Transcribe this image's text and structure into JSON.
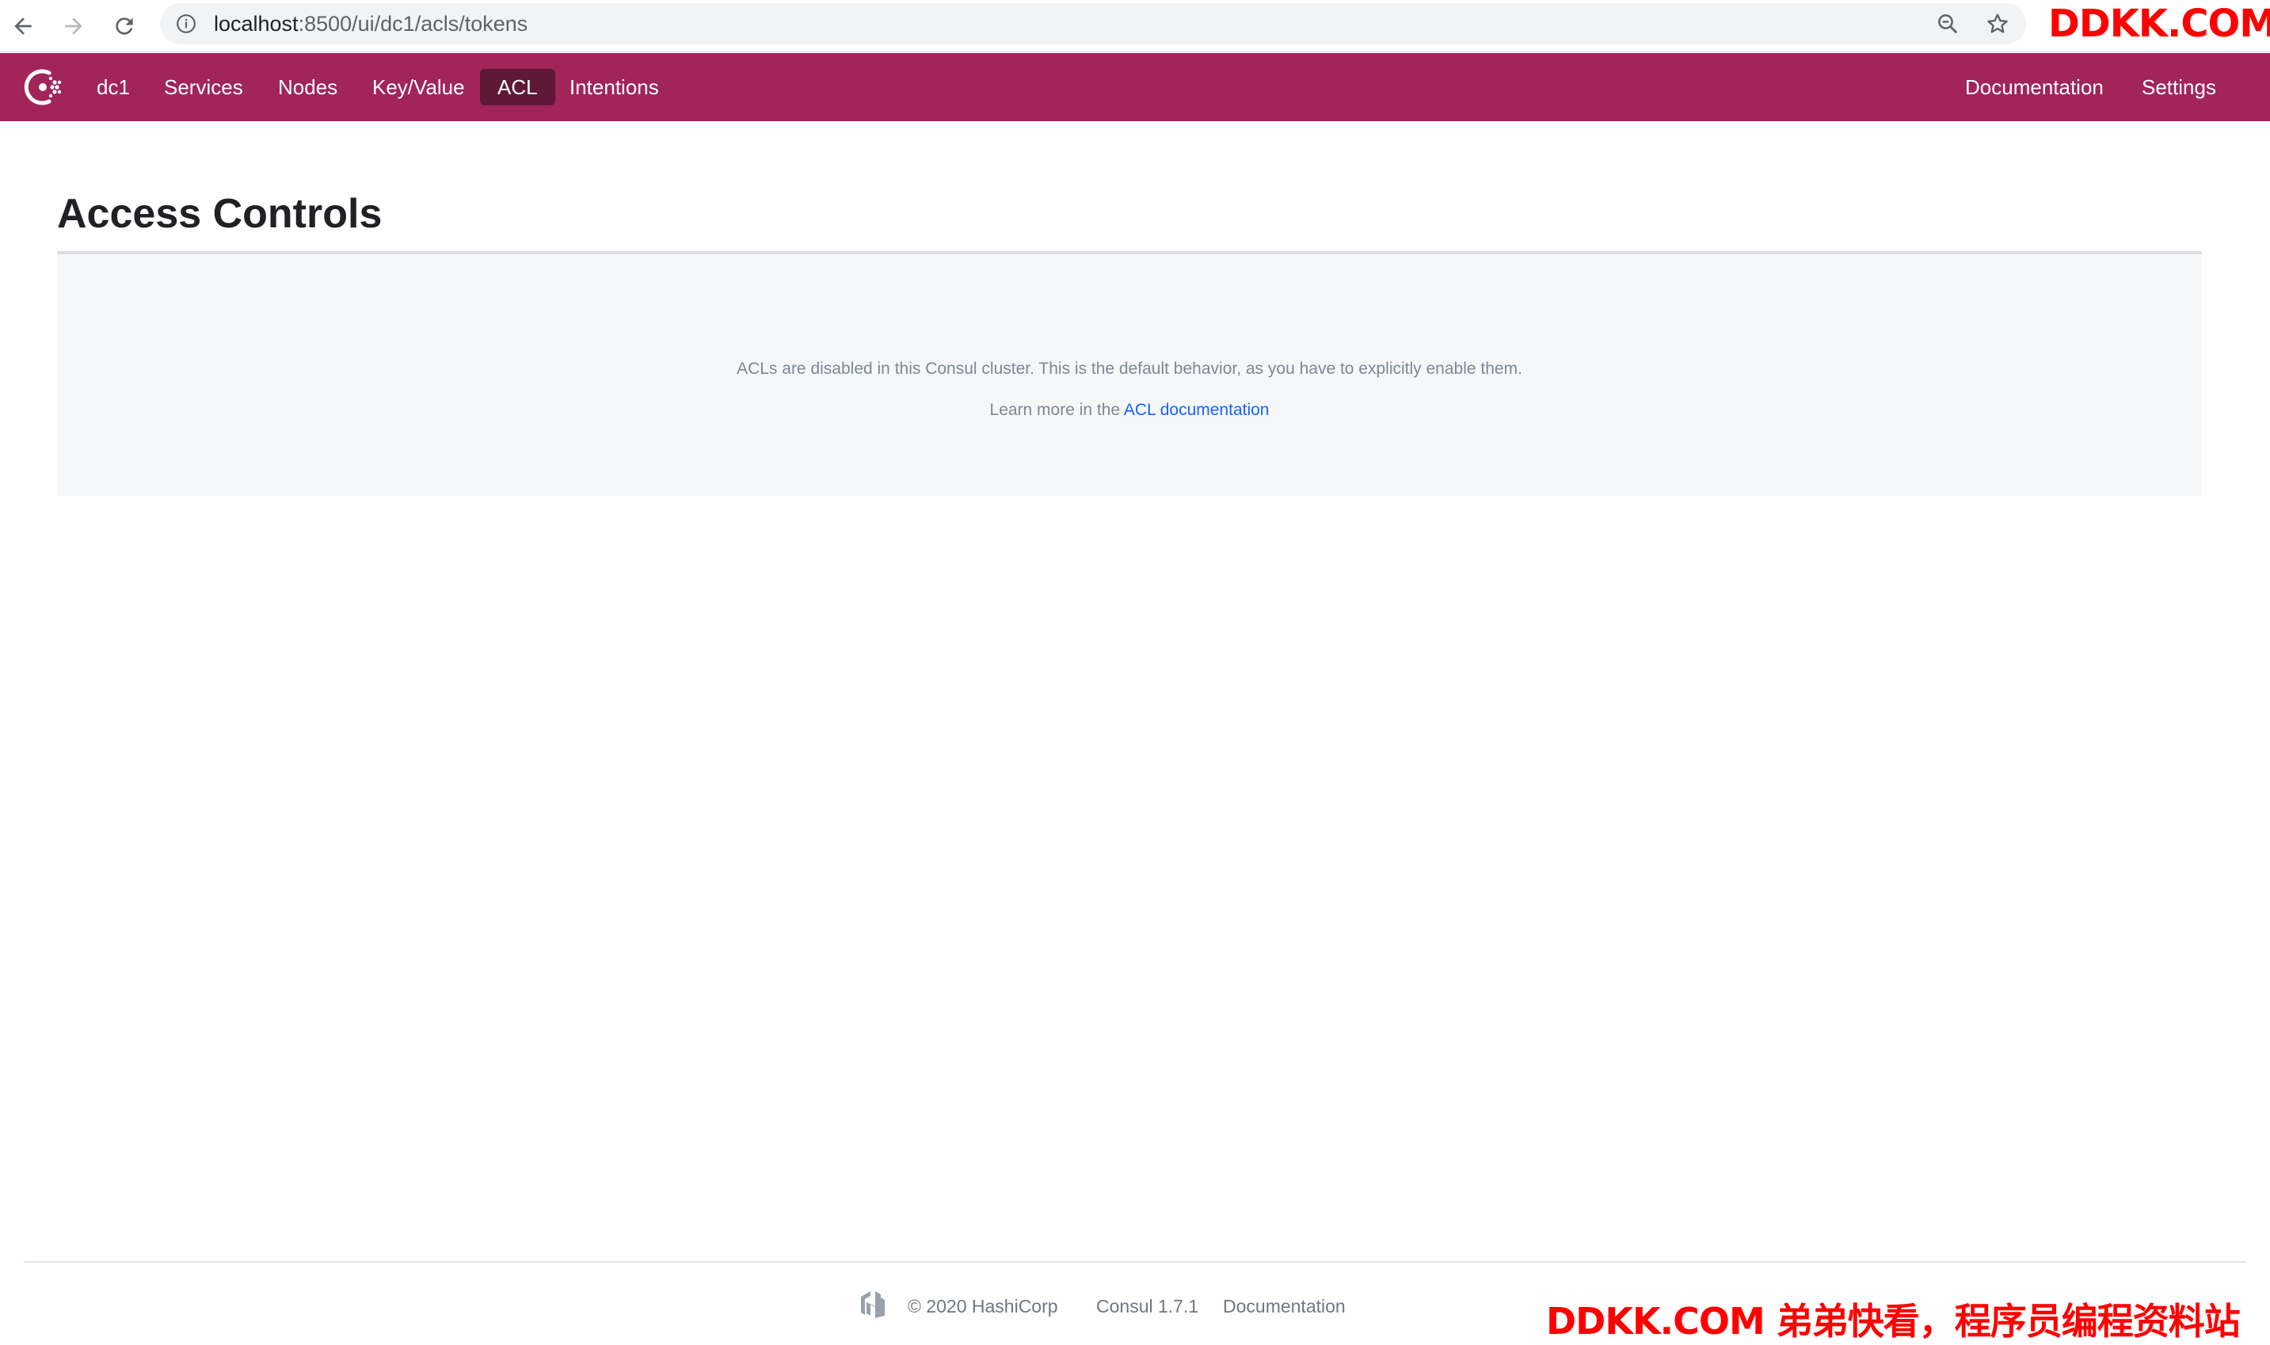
{
  "browser": {
    "url_host": "localhost",
    "url_path": ":8500/ui/dc1/acls/tokens",
    "icons": [
      "back-icon",
      "forward-icon",
      "reload-icon",
      "info-icon",
      "zoom-icon",
      "star-icon"
    ]
  },
  "header": {
    "datacenter": "dc1",
    "nav": {
      "services": "Services",
      "nodes": "Nodes",
      "key_value": "Key/Value",
      "acl": "ACL",
      "intentions": "Intentions"
    },
    "right": {
      "documentation": "Documentation",
      "settings": "Settings"
    },
    "active_tab": "ACL",
    "brand_color": "#a1245b",
    "active_color": "#5e1838"
  },
  "main": {
    "title": "Access Controls",
    "empty_message": "ACLs are disabled in this Consul cluster. This is the default behavior, as you have to explicitly enable them.",
    "learn_more_prefix": "Learn more in the",
    "learn_more_link": "ACL documentation",
    "link_color": "#1563ff"
  },
  "footer": {
    "copyright": "© 2020 HashiCorp",
    "version": "Consul 1.7.1",
    "documentation": "Documentation"
  },
  "watermarks": {
    "top": "DDKK.COM",
    "bottom": "DDKK.COM 弟弟快看，程序员编程资料站"
  }
}
